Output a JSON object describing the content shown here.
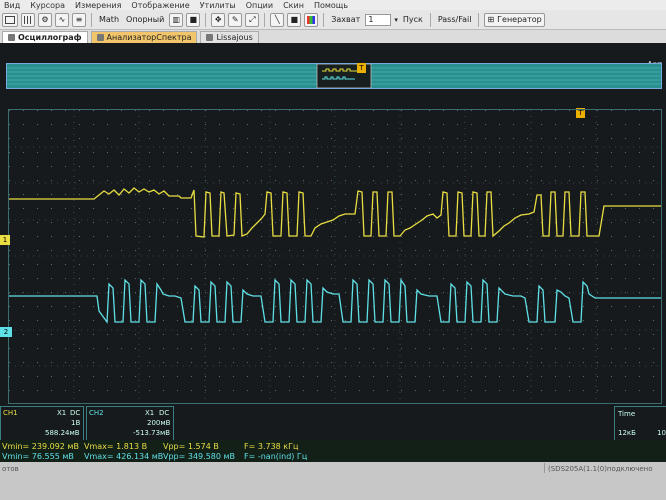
{
  "menu": [
    "Вид",
    "Курсора",
    "Измерения",
    "Отображение",
    "Утилиты",
    "Опции",
    "Скин",
    "Помощь"
  ],
  "toolbar": {
    "math": "Math",
    "ref": "Опорный",
    "capture": "Захват",
    "capture_value": "1",
    "start": "Пуск",
    "passfail": "Pass/Fail",
    "generator": "Генератор"
  },
  "tabs": [
    {
      "label": "Осциллограф"
    },
    {
      "label": "АнализаторСпектра"
    },
    {
      "label": "Lissajous"
    }
  ],
  "overview": {
    "mode": "Авт"
  },
  "markers": {
    "trigger": "T",
    "ch1": "1",
    "ch2": "2"
  },
  "channels": {
    "ch1": {
      "name": "CH1",
      "probe": "X1",
      "coupling": "DC",
      "scale": "1В",
      "offset": "588.24мВ",
      "color": "#e9dd42"
    },
    "ch2": {
      "name": "CH2",
      "probe": "X1",
      "coupling": "DC",
      "scale": "200мВ",
      "offset": "-513.73мВ",
      "color": "#5fe0e6"
    }
  },
  "time": {
    "label": "Time",
    "value": "12кБ",
    "extra": "10"
  },
  "measurements": {
    "ch1_vmin": "Vmin= 239.092 мВ",
    "ch1_vmax": "Vmax= 1.813 В",
    "ch1_vpp": "Vpp= 1.574 В",
    "ch1_freq": "F= 3.738 кГц",
    "ch2_vmin": "Vmin= 76.555 мВ",
    "ch2_vmax": "Vmax= 426.134 мВ",
    "ch2_vpp": "Vpp= 349.580 мВ",
    "ch2_freq": "F= -nan(ind) Гц"
  },
  "statusbar": {
    "left": "отов",
    "right": "(SDS205A(1.1(0)подключено"
  }
}
